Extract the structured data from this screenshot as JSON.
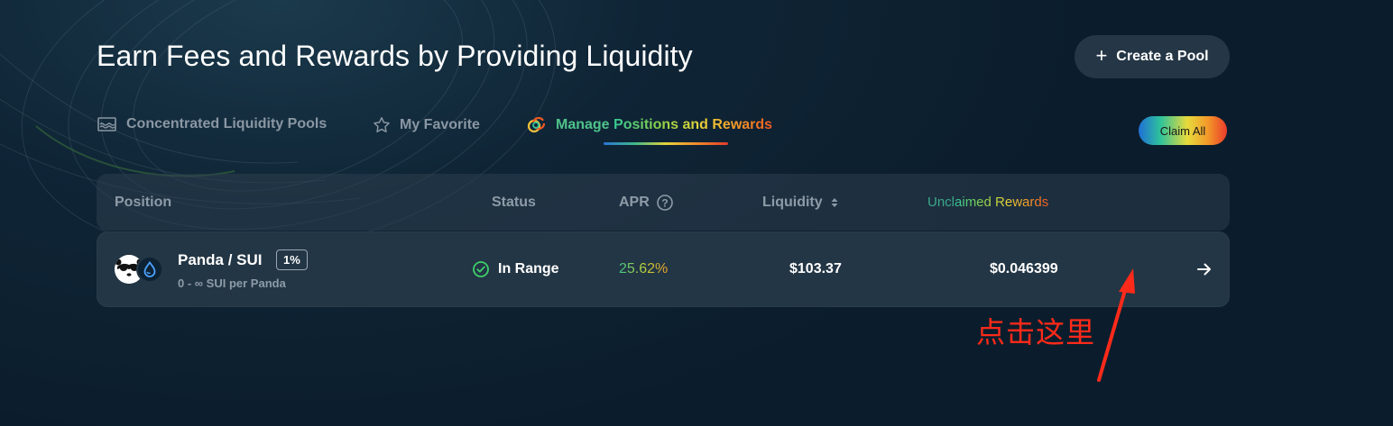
{
  "page": {
    "title": "Earn Fees and Rewards by Providing Liquidity",
    "create_pool_label": "Create a Pool"
  },
  "tabs": [
    {
      "label": "Concentrated Liquidity Pools",
      "icon": "pool-icon",
      "active": false
    },
    {
      "label": "My Favorite",
      "icon": "star-icon",
      "active": false
    },
    {
      "label_part1": "Manage",
      "label_part2": " Positions and Rewards",
      "icon": "rings-icon",
      "active": true
    }
  ],
  "claim_all_label": "Claim All",
  "table": {
    "headers": {
      "position": "Position",
      "status": "Status",
      "apr": "APR",
      "liquidity": "Liquidity",
      "rewards_part1": "Uncl",
      "rewards_part2": "aimed Rewards"
    },
    "rows": [
      {
        "pair": "Panda / SUI",
        "fee": "1%",
        "range": "0 - ∞ SUI per Panda",
        "status": "In Range",
        "apr": "25.62%",
        "liquidity": "$103.37",
        "rewards": "$0.046399"
      }
    ]
  },
  "annotation": {
    "text": "点击这里",
    "color": "#ff2a1a"
  },
  "colors": {
    "background": "#0f2536",
    "row_bg": "#233645",
    "status_ok": "#3ecf6b"
  }
}
